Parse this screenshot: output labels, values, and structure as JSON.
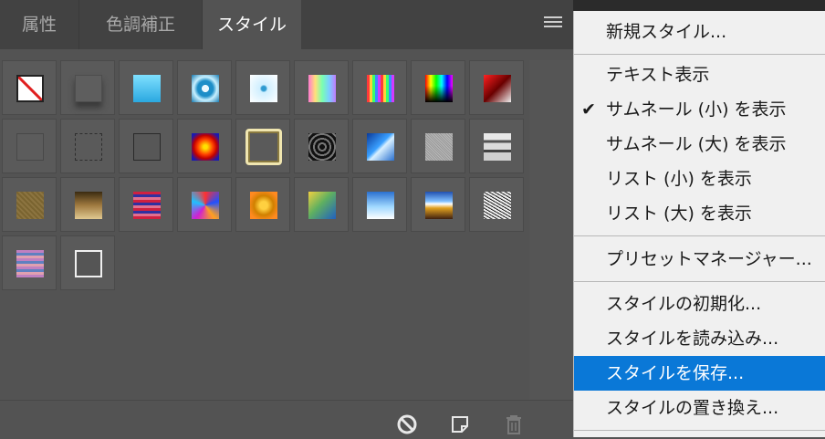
{
  "tabs": [
    {
      "label": "属性",
      "active": false
    },
    {
      "label": "色調補正",
      "active": false
    },
    {
      "label": "スタイル",
      "active": true
    }
  ],
  "styles_grid": {
    "rows": [
      [
        "none",
        "drop-shadow-gray",
        "cyan-gradient",
        "blue-bevel",
        "light-blue-inner",
        "rainbow-pastel",
        "rainbow-stripes",
        "spectrum",
        "red-black-gradient"
      ],
      [
        "gray-solid",
        "dotted-outline",
        "dark-outline",
        "red-sunburst",
        "gold-frame",
        "black-rings",
        "blue-sky",
        "gray-noise",
        "chrome-drip"
      ],
      [
        "brown-texture",
        "brown-gradient",
        "striped-purple-red",
        "psychedelic",
        "gold-glow",
        "yellow-blue",
        "blue-white",
        "sunset",
        "noise-white"
      ],
      [
        "pastel-stripes",
        "white-outline"
      ]
    ]
  },
  "footer": {
    "icons": [
      "clear-style-icon",
      "new-style-icon",
      "trash-icon"
    ]
  },
  "menu": {
    "items": [
      {
        "label": "新規スタイル...",
        "checked": false,
        "selected": false
      },
      {
        "separator": true
      },
      {
        "label": "テキスト表示",
        "checked": false,
        "selected": false
      },
      {
        "label": "サムネール (小) を表示",
        "checked": true,
        "selected": false
      },
      {
        "label": "サムネール (大) を表示",
        "checked": false,
        "selected": false
      },
      {
        "label": "リスト (小) を表示",
        "checked": false,
        "selected": false
      },
      {
        "label": "リスト (大) を表示",
        "checked": false,
        "selected": false
      },
      {
        "separator": true
      },
      {
        "label": "プリセットマネージャー...",
        "checked": false,
        "selected": false
      },
      {
        "separator": true
      },
      {
        "label": "スタイルの初期化...",
        "checked": false,
        "selected": false
      },
      {
        "label": "スタイルを読み込み...",
        "checked": false,
        "selected": false
      },
      {
        "label": "スタイルを保存...",
        "checked": false,
        "selected": true
      },
      {
        "label": "スタイルの置き換え...",
        "checked": false,
        "selected": false
      }
    ],
    "check_glyph": "✔"
  },
  "colors": {
    "panel_bg": "#535353",
    "tab_bar_bg": "#424242",
    "menu_bg": "#f0f0f0",
    "menu_highlight": "#0a78d7"
  }
}
